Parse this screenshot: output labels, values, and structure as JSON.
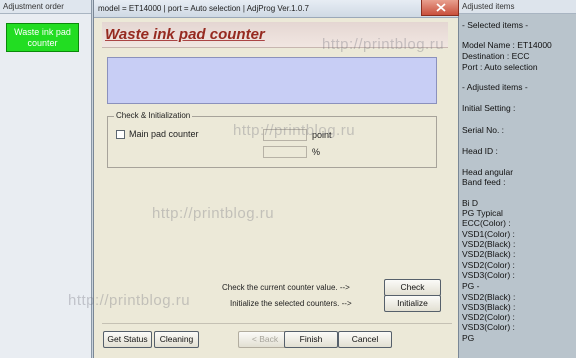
{
  "left_window": {
    "title": "Adjustment order",
    "active_item": "Waste ink pad counter"
  },
  "dialog": {
    "title": "model = ET14000 | port = Auto selection | AdjProg Ver.1.0.7",
    "banner_title": "Waste ink pad counter",
    "group_label": "Check & Initialization",
    "main_pad_label": "Main pad counter",
    "unit_point": "point",
    "unit_percent": "%",
    "check_text": "Check the current counter value. -->",
    "check_btn": "Check",
    "init_text": "Initialize the selected counters. -->",
    "init_btn": "Initialize",
    "buttons": {
      "get_status": "Get Status",
      "cleaning": "Cleaning",
      "back": "< Back",
      "finish": "Finish",
      "cancel": "Cancel"
    }
  },
  "right_window": {
    "title": "Adjusted items",
    "lines": [
      "- Selected items -",
      "Model Name : ET14000",
      "Destination : ECC",
      "Port : Auto selection",
      "- Adjusted items -",
      "Initial Setting :",
      "Serial No. :",
      "Head ID :",
      "Head angular",
      " Band feed :",
      "Bi D",
      "PG Typical",
      " ECC(Color) :",
      " VSD1(Color) :",
      " VSD2(Black) :",
      " VSD2(Black) :",
      " VSD2(Color) :",
      " VSD3(Color) :",
      "PG -",
      " VSD2(Black) :",
      " VSD3(Black) :",
      " VSD2(Color) :",
      " VSD3(Color) :",
      "PG"
    ]
  },
  "watermark": "http://printblog.ru",
  "colors": {
    "accent_green": "#22dd22",
    "banner_text": "#962a20",
    "info_area": "#c8cef5",
    "close_red": "#c9503c"
  }
}
